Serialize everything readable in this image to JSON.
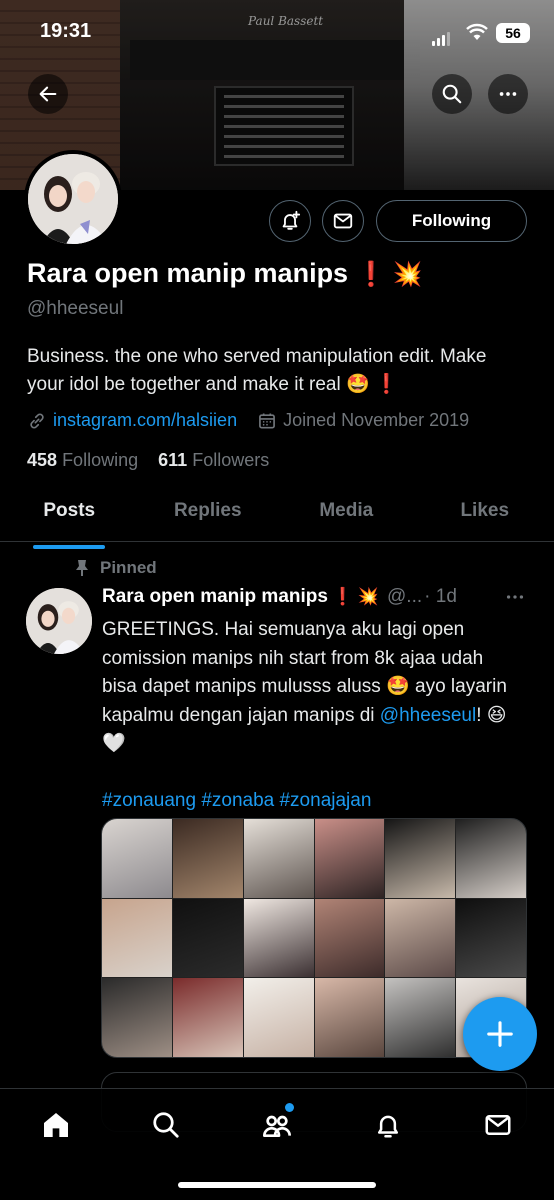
{
  "status_bar": {
    "time": "19:31",
    "battery": "56"
  },
  "banner": {
    "brand_text": "Paul Bassett"
  },
  "profile": {
    "display_name": "Rara open manip manips",
    "name_emoji": "❗ 💥",
    "handle": "@hheeseul",
    "bio": "Business. the one who served manipulation edit. Make your idol be together and make it real 🤩 ❗",
    "link": "instagram.com/halsiien",
    "joined": "Joined November 2019",
    "following_count": "458",
    "following_label": "Following",
    "followers_count": "611",
    "followers_label": "Followers",
    "follow_button_label": "Following"
  },
  "tabs": [
    {
      "label": "Posts",
      "active": true
    },
    {
      "label": "Replies",
      "active": false
    },
    {
      "label": "Media",
      "active": false
    },
    {
      "label": "Likes",
      "active": false
    }
  ],
  "pinned_post": {
    "pinned_label": "Pinned",
    "author_name": "Rara open manip manips",
    "author_emoji": "❗ 💥",
    "author_handle": "@...",
    "time": "· 1d",
    "text_1": "GREETINGS. Hai semuanya aku lagi open comission manips nih start from 8k ajaa udah bisa dapet manips mulusss aluss 🤩 ayo layarin kapalmu dengan jajan manips di ",
    "mention": "@hheeseul",
    "text_2": "! 😆 🤍",
    "hashtags": "#zonauang #zonaba #zonajajan"
  },
  "colors": {
    "accent": "#1d9bf0",
    "muted": "#71767b",
    "text": "#e7e9ea",
    "border": "#2f3336"
  },
  "icons": {
    "back": "arrow-left-icon",
    "search": "search-icon",
    "more": "more-icon",
    "notify": "bell-plus-icon",
    "message": "mail-icon",
    "link": "link-icon",
    "calendar": "calendar-icon",
    "pin": "pin-icon",
    "compose": "plus-icon",
    "nav": [
      "home-icon",
      "search-icon",
      "communities-icon",
      "bell-icon",
      "mail-icon"
    ]
  }
}
